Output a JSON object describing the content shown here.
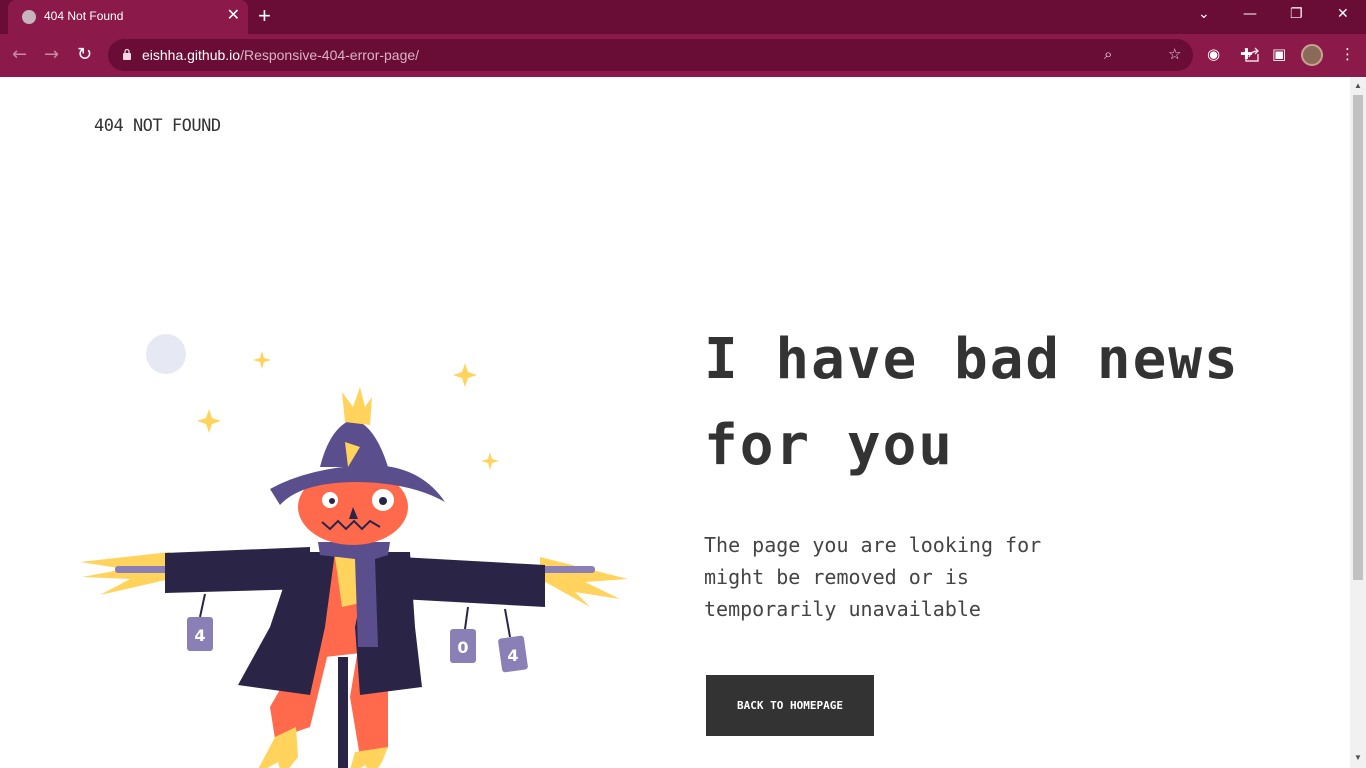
{
  "browser": {
    "tab_title": "404 Not Found",
    "tab_close": "✕",
    "new_tab": "+",
    "url_host": "eishha.github.io",
    "url_path": "/Responsive-404-error-page/",
    "window_controls": {
      "tabsearch": "⌄",
      "minimize": "—",
      "restore": "❐",
      "close": "✕"
    }
  },
  "page": {
    "brand": "404 NOT FOUND",
    "headline": "I have bad news for you",
    "subtext": "The page you are looking for might be removed or is temporarily unavailable",
    "cta_label": "BACK TO HOMEPAGE",
    "can_labels": [
      "4",
      "0",
      "4"
    ]
  },
  "colors": {
    "chrome_dark": "#6a0d36",
    "chrome": "#8b1a4a",
    "text_dark": "#333333",
    "scarecrow_orange": "#ff6a4d",
    "scarecrow_navy": "#2a2447",
    "hat_purple": "#5a4f8c",
    "straw_yellow": "#ffd35c",
    "can_purple": "#8a80b5"
  },
  "icons": [
    "back-arrow-icon",
    "forward-arrow-icon",
    "reload-icon",
    "lock-icon",
    "zoom-icon",
    "share-icon",
    "star-icon",
    "extension-icon",
    "puzzle-icon",
    "sidepanel-icon",
    "menu-icon"
  ]
}
